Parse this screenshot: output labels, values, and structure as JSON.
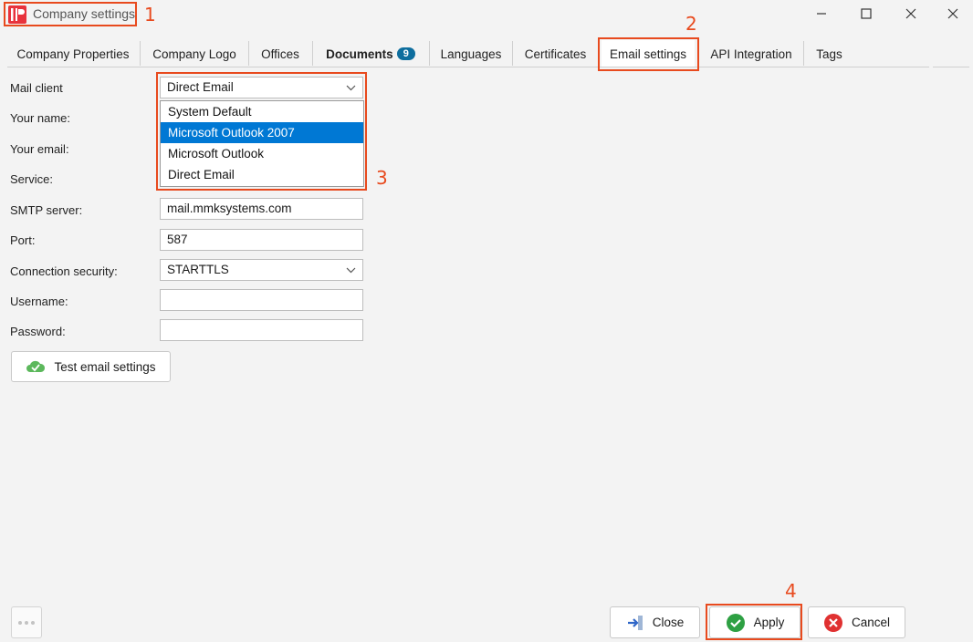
{
  "window": {
    "title": "Company settings",
    "controls": {
      "minimize": "minimize",
      "maximize": "maximize",
      "close": "close"
    }
  },
  "annotations": {
    "n1": "1",
    "n2": "2",
    "n3": "3",
    "n4": "4",
    "color": "#e84a1e"
  },
  "tabs": [
    {
      "label": "Company Properties"
    },
    {
      "label": "Company Logo"
    },
    {
      "label": "Offices"
    },
    {
      "label": "Documents",
      "badge": "9"
    },
    {
      "label": "Languages"
    },
    {
      "label": "Certificates"
    },
    {
      "label": "Email settings",
      "active": true
    },
    {
      "label": "API Integration"
    },
    {
      "label": "Tags"
    }
  ],
  "form": {
    "mail_client": {
      "label": "Mail client",
      "value": "Direct Email"
    },
    "your_name": {
      "label": "Your name:"
    },
    "your_email": {
      "label": "Your email:"
    },
    "service": {
      "label": "Service:"
    },
    "smtp_server": {
      "label": "SMTP server:",
      "value": "mail.mmksystems.com"
    },
    "port": {
      "label": "Port:",
      "value": "587"
    },
    "connection_security": {
      "label": "Connection security:",
      "value": "STARTTLS"
    },
    "username": {
      "label": "Username:",
      "value": ""
    },
    "password": {
      "label": "Password:",
      "value": ""
    },
    "test_button": "Test email settings"
  },
  "dropdown": {
    "options": [
      "System Default",
      "Microsoft Outlook 2007",
      "Microsoft Outlook",
      "Direct Email"
    ],
    "highlighted": "Microsoft Outlook 2007"
  },
  "footer": {
    "close": "Close",
    "apply": "Apply",
    "cancel": "Cancel"
  },
  "colors": {
    "accent": "#0078d4",
    "badge": "#0e6e9e",
    "apply_green": "#2ea043",
    "cancel_red": "#e03131",
    "brand_red": "#e8323c"
  },
  "icons": [
    "app-logo-icon",
    "minimize-icon",
    "maximize-icon",
    "close-icon",
    "chevron-down-icon",
    "cloud-check-icon",
    "arrow-right-icon",
    "check-circle-icon",
    "x-circle-icon",
    "more-dots-icon"
  ]
}
